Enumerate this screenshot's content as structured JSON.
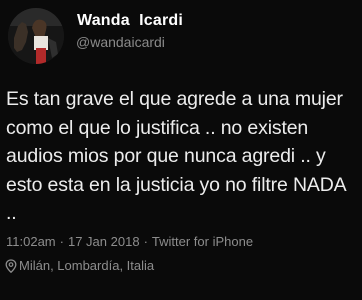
{
  "author": {
    "display_name": "Wanda  Icardi",
    "handle": "@wandaicardi",
    "avatar_icon": "profile-photo"
  },
  "tweet": {
    "text": "Es tan grave el que agrede a una mujer como el que lo justifica .. no existen audios mios por que nunca agredi .. y esto esta en la justicia yo no filtre NADA ..",
    "time": "11:02am",
    "separator": "·",
    "date": "17 Jan 2018",
    "source": "Twitter for iPhone",
    "location": "Milán, Lombardía, Italia",
    "location_icon": "map-pin-icon"
  },
  "colors": {
    "background": "#0a0a0a",
    "text": "#ececec",
    "secondary": "#8d8d8d"
  }
}
